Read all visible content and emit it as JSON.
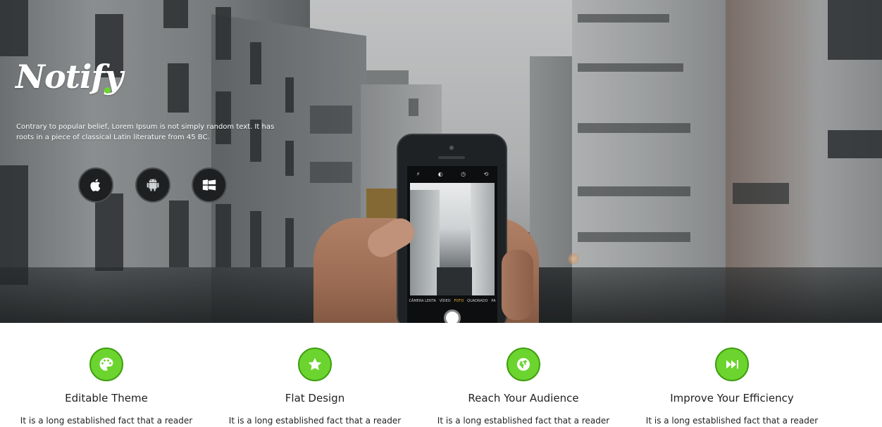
{
  "hero": {
    "brand": "Notify",
    "description": "Contrary to popular belief, Lorem Ipsum is not simply random text. It has roots in a piece of classical Latin literature from 45 BC.",
    "platforms": [
      {
        "name": "apple",
        "icon": "apple-icon"
      },
      {
        "name": "android",
        "icon": "android-icon"
      },
      {
        "name": "windows",
        "icon": "windows-icon"
      }
    ],
    "phone": {
      "modes": [
        "CÂMERA LENTA",
        "VÍDEO",
        "FOTO",
        "QUADRADO",
        "PA"
      ],
      "active_mode": "FOTO"
    }
  },
  "features": [
    {
      "icon": "palette-icon",
      "title": "Editable Theme",
      "desc": "It is a long established fact that a reader"
    },
    {
      "icon": "star-icon",
      "title": "Flat Design",
      "desc": "It is a long established fact that a reader"
    },
    {
      "icon": "globe-icon",
      "title": "Reach Your Audience",
      "desc": "It is a long established fact that a reader"
    },
    {
      "icon": "fast-forward-icon",
      "title": "Improve Your Efficiency",
      "desc": "It is a long established fact that a reader"
    }
  ],
  "colors": {
    "accent": "#6cd42e",
    "accent_border": "#3f9e12",
    "button_dark": "#1d1f21",
    "text": "#222222"
  }
}
